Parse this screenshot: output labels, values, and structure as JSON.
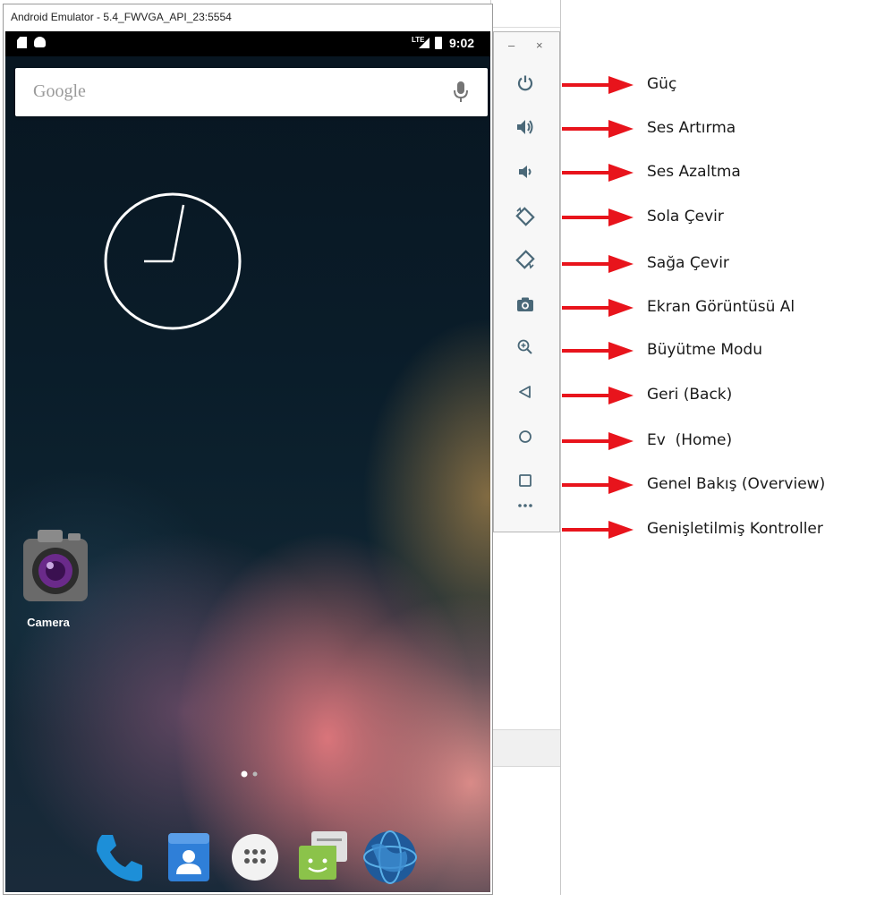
{
  "emulator": {
    "title": "Android Emulator - 5.4_FWVGA_API_23:5554"
  },
  "status_bar": {
    "network": "LTE",
    "time": "9:02"
  },
  "search": {
    "placeholder": "Google"
  },
  "apps": {
    "camera_label": "Camera"
  },
  "dock": {
    "items": [
      "phone-icon",
      "contacts-icon",
      "app-drawer-icon",
      "messenger-icon",
      "browser-icon"
    ]
  },
  "toolbar": {
    "minimize_label": "–",
    "close_label": "×",
    "tools": [
      {
        "icon": "power-icon",
        "label": "Güç"
      },
      {
        "icon": "volume-up-icon",
        "label": "Ses Artırma"
      },
      {
        "icon": "volume-down-icon",
        "label": "Ses Azaltma"
      },
      {
        "icon": "rotate-left-icon",
        "label": "Sola Çevir"
      },
      {
        "icon": "rotate-right-icon",
        "label": "Sağa Çevir"
      },
      {
        "icon": "camera-icon",
        "label": "Ekran Görüntüsü Al"
      },
      {
        "icon": "zoom-icon",
        "label": "Büyütme Modu"
      },
      {
        "icon": "back-icon",
        "label": "Geri (Back)"
      },
      {
        "icon": "home-icon",
        "label": "Ev  (Home)"
      },
      {
        "icon": "overview-icon",
        "label": "Genel Bakış (Overview)"
      },
      {
        "icon": "more-icon",
        "label": "Genişletilmiş Kontroller"
      }
    ]
  },
  "colors": {
    "arrow": "#e8141c",
    "toolbar_icon": "#4a6878"
  }
}
